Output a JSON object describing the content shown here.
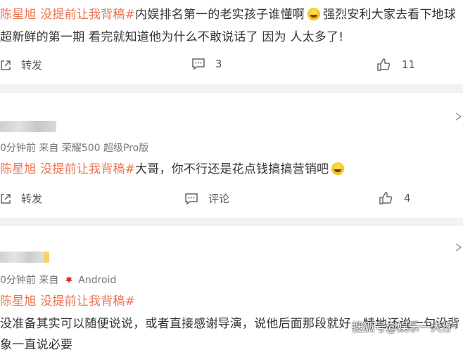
{
  "comment1": {
    "line1": {
      "topic": "陈星旭 没提前让我背稿#",
      "text_a": "内娱排名第一的老实孩子谁懂啊",
      "text_b": "强烈安利大家去看下地球"
    },
    "line2": "超新鲜的第一期 看完就知道他为什么不敢说话了 因为 人太多了!",
    "share_label": "转发",
    "comment_count": "3",
    "like_count": "11"
  },
  "comment2": {
    "meta": "0分钟前  来自 荣耀500 超级Pro版",
    "topic": "陈星旭 没提前让我背稿#",
    "text": "大哥，你不行还是花点钱搞搞营销吧",
    "share_label": "转发",
    "comment_label": "评论",
    "like_count": "4"
  },
  "comment3": {
    "meta_prefix": "0分钟前  来自",
    "meta_source": "Android",
    "topic": "陈星旭 没提前让我背稿#",
    "line1": "没准备其实可以随便说说，或者直接感谢导演，说他后面那段就好，特地还说一句没背",
    "line2": "象一直说必要"
  },
  "watermark": "搜狐号@娱乐一大仔",
  "colors": {
    "topic": "#eb7350",
    "separator": "#f2f2f2",
    "text": "#333333",
    "meta": "#777777"
  },
  "icons": [
    "share-icon",
    "comment-icon",
    "like-icon",
    "chevron-down-icon",
    "android-icon",
    "laughing-emoji-icon"
  ]
}
